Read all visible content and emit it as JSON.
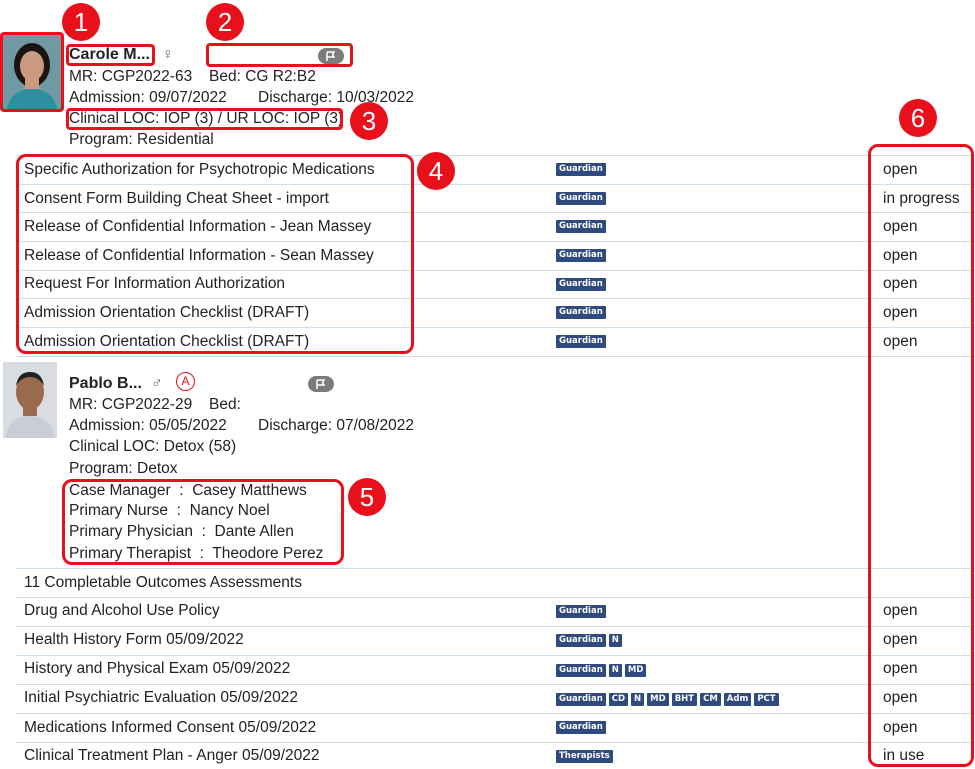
{
  "patient1": {
    "name": "Carole M...",
    "gender_symbol": "♀",
    "mr": "MR: CGP2022-63",
    "bed": "Bed: CG R2:B2",
    "admission": "Admission: 09/07/2022",
    "discharge": "Discharge: 10/03/2022",
    "loc": "Clinical LOC: IOP (3) / UR LOC: IOP (3)",
    "program": "Program: Residential"
  },
  "forms1": [
    {
      "title": "Specific Authorization for Psychotropic Medications",
      "badges": [
        "Guardian"
      ],
      "status": "open"
    },
    {
      "title": "Consent Form Building Cheat Sheet - import",
      "badges": [
        "Guardian"
      ],
      "status": "in progress"
    },
    {
      "title": "Release of Confidential Information - Jean Massey",
      "badges": [
        "Guardian"
      ],
      "status": "open"
    },
    {
      "title": "Release of Confidential Information - Sean Massey",
      "badges": [
        "Guardian"
      ],
      "status": "open"
    },
    {
      "title": "Request For Information Authorization",
      "badges": [
        "Guardian"
      ],
      "status": "open"
    },
    {
      "title": "Admission Orientation Checklist (DRAFT)",
      "badges": [
        "Guardian"
      ],
      "status": "open"
    },
    {
      "title": "Admission Orientation Checklist (DRAFT)",
      "badges": [
        "Guardian"
      ],
      "status": "open"
    }
  ],
  "patient2": {
    "name": "Pablo B...",
    "gender_symbol": "♂",
    "alert_symbol": "A",
    "mr": "MR: CGP2022-29",
    "bed": "Bed:",
    "admission": "Admission: 05/05/2022",
    "discharge": "Discharge: 07/08/2022",
    "loc": "Clinical LOC: Detox (58)",
    "program": "Program: Detox",
    "care_team": [
      "Case Manager  :  Casey Matthews",
      "Primary Nurse  :  Nancy Noel",
      "Primary Physician  :  Dante Allen",
      "Primary Therapist  :  Theodore Perez"
    ]
  },
  "outcomes_header": "11 Completable Outcomes Assessments",
  "forms2": [
    {
      "title": "Drug and Alcohol Use Policy",
      "badges": [
        "Guardian"
      ],
      "status": "open"
    },
    {
      "title": "Health History Form 05/09/2022",
      "badges": [
        "Guardian",
        "N"
      ],
      "status": "open"
    },
    {
      "title": "History and Physical Exam 05/09/2022",
      "badges": [
        "Guardian",
        "N",
        "MD"
      ],
      "status": "open"
    },
    {
      "title": "Initial Psychiatric Evaluation 05/09/2022",
      "badges": [
        "Guardian",
        "CD",
        "N",
        "MD",
        "BHT",
        "CM",
        "Adm",
        "PCT"
      ],
      "status": "open"
    },
    {
      "title": "Medications Informed Consent 05/09/2022",
      "badges": [
        "Guardian"
      ],
      "status": "open"
    },
    {
      "title": "Clinical Treatment Plan - Anger 05/09/2022",
      "badges": [
        "Therapists"
      ],
      "status": "in use"
    }
  ],
  "annotations": [
    "1",
    "2",
    "3",
    "4",
    "5",
    "6"
  ],
  "colors": {
    "badge": "#2f4a7f",
    "annotation": "#e8101b",
    "divider": "#cfe0ec",
    "flag": "#7b7b7b"
  },
  "icons": {
    "flag": "flag-icon",
    "avatar": "avatar-photo"
  }
}
